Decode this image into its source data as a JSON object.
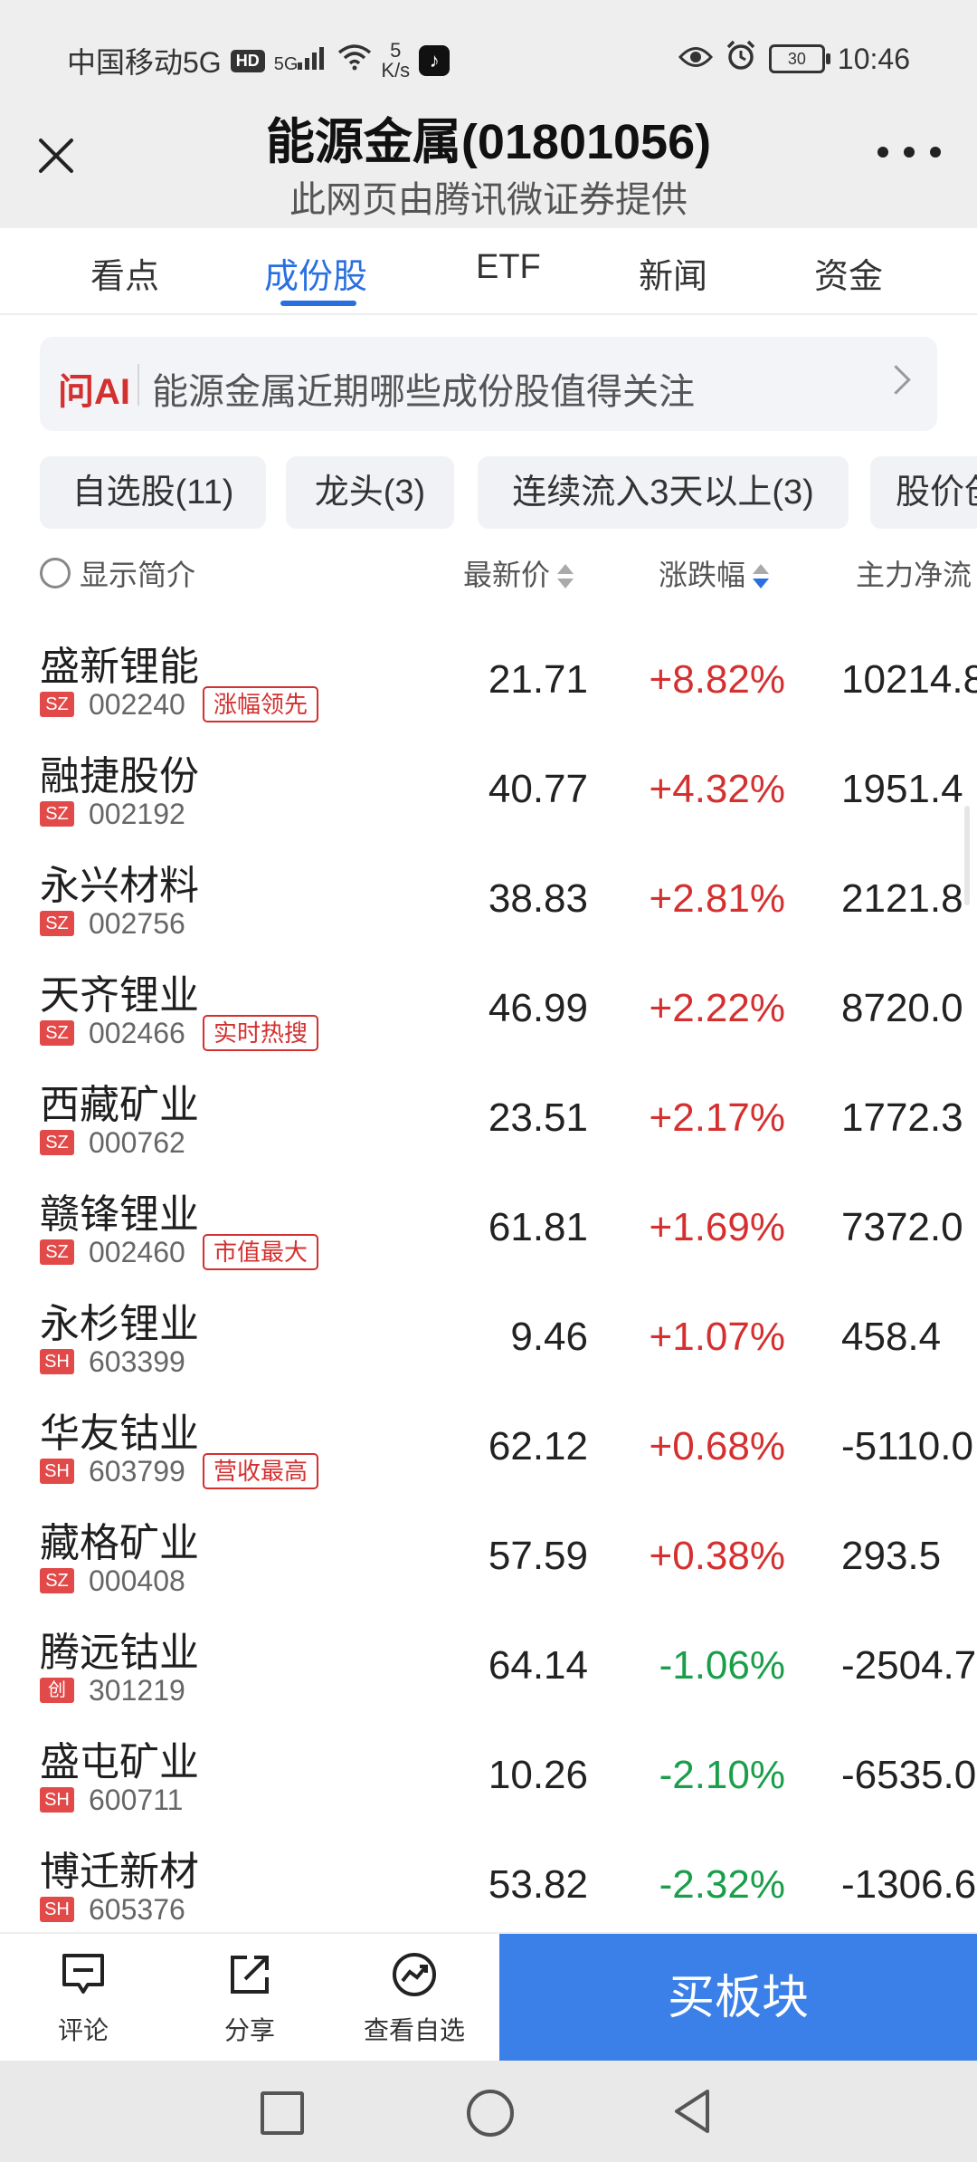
{
  "status_bar": {
    "carrier": "中国移动5G",
    "hd": "HD",
    "signal": "5G",
    "net_speed_value": "5",
    "net_speed_unit": "K/s",
    "battery": "30",
    "time": "10:46"
  },
  "header": {
    "title": "能源金属(01801056)",
    "subtitle": "此网页由腾讯微证券提供"
  },
  "tabs": [
    {
      "label": "看点",
      "active": false
    },
    {
      "label": "成份股",
      "active": true
    },
    {
      "label": "ETF",
      "active": false
    },
    {
      "label": "新闻",
      "active": false
    },
    {
      "label": "资金",
      "active": false
    }
  ],
  "ai_bar": {
    "tag": "问AI",
    "text": "能源金属近期哪些成份股值得关注"
  },
  "filters": [
    "自选股(11)",
    "龙头(3)",
    "连续流入3天以上(3)",
    "股价创"
  ],
  "columns": {
    "intro_toggle": "显示简介",
    "price": "最新价",
    "change": "涨跌幅",
    "flow": "主力净流"
  },
  "stocks": [
    {
      "name": "盛新锂能",
      "exchange": "SZ",
      "code": "002240",
      "tag": "涨幅领先",
      "price": "21.71",
      "change": "+8.82%",
      "direction": "up",
      "flow": "10214.8"
    },
    {
      "name": "融捷股份",
      "exchange": "SZ",
      "code": "002192",
      "tag": "",
      "price": "40.77",
      "change": "+4.32%",
      "direction": "up",
      "flow": "1951.4"
    },
    {
      "name": "永兴材料",
      "exchange": "SZ",
      "code": "002756",
      "tag": "",
      "price": "38.83",
      "change": "+2.81%",
      "direction": "up",
      "flow": "2121.8"
    },
    {
      "name": "天齐锂业",
      "exchange": "SZ",
      "code": "002466",
      "tag": "实时热搜",
      "price": "46.99",
      "change": "+2.22%",
      "direction": "up",
      "flow": "8720.0"
    },
    {
      "name": "西藏矿业",
      "exchange": "SZ",
      "code": "000762",
      "tag": "",
      "price": "23.51",
      "change": "+2.17%",
      "direction": "up",
      "flow": "1772.3"
    },
    {
      "name": "赣锋锂业",
      "exchange": "SZ",
      "code": "002460",
      "tag": "市值最大",
      "price": "61.81",
      "change": "+1.69%",
      "direction": "up",
      "flow": "7372.0"
    },
    {
      "name": "永杉锂业",
      "exchange": "SH",
      "code": "603399",
      "tag": "",
      "price": "9.46",
      "change": "+1.07%",
      "direction": "up",
      "flow": "458.4"
    },
    {
      "name": "华友钴业",
      "exchange": "SH",
      "code": "603799",
      "tag": "营收最高",
      "price": "62.12",
      "change": "+0.68%",
      "direction": "up",
      "flow": "-5110.0"
    },
    {
      "name": "藏格矿业",
      "exchange": "SZ",
      "code": "000408",
      "tag": "",
      "price": "57.59",
      "change": "+0.38%",
      "direction": "up",
      "flow": "293.5"
    },
    {
      "name": "腾远钴业",
      "exchange": "创",
      "code": "301219",
      "tag": "",
      "price": "64.14",
      "change": "-1.06%",
      "direction": "down",
      "flow": "-2504.7"
    },
    {
      "name": "盛屯矿业",
      "exchange": "SH",
      "code": "600711",
      "tag": "",
      "price": "10.26",
      "change": "-2.10%",
      "direction": "down",
      "flow": "-6535.0"
    },
    {
      "name": "博迁新材",
      "exchange": "SH",
      "code": "605376",
      "tag": "",
      "price": "53.82",
      "change": "-2.32%",
      "direction": "down",
      "flow": "-1306.6"
    }
  ],
  "toolbar": {
    "comment": "评论",
    "share": "分享",
    "watchlist": "查看自选",
    "buy": "买板块"
  },
  "colors": {
    "accent": "#2a6fe0",
    "up": "#d43030",
    "down": "#1a9e4a",
    "buy_button": "#3b7fe8"
  },
  "icons": {
    "close": "close-icon",
    "more": "more-icon",
    "comment": "comment-icon",
    "share": "share-icon",
    "watchlist": "trend-icon"
  }
}
